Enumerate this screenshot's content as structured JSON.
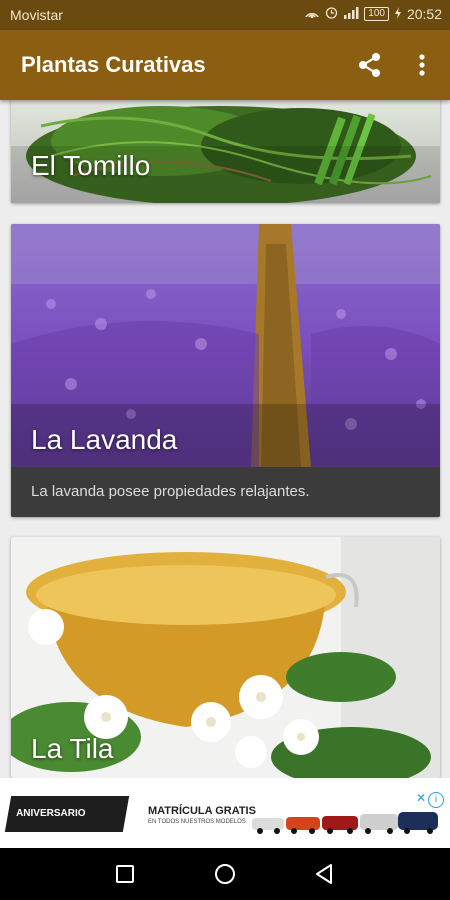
{
  "status_bar": {
    "carrier": "Movistar",
    "battery": "100",
    "time": "20:52"
  },
  "app_bar": {
    "title": "Plantas Curativas",
    "icons": [
      "share-icon",
      "more-vert-icon"
    ]
  },
  "cards": [
    {
      "title": "El Tomillo",
      "description": ""
    },
    {
      "title": "La Lavanda",
      "description": "La lavanda posee propiedades relajantes."
    },
    {
      "title": "La Tila",
      "description": ""
    }
  ],
  "ad": {
    "badge": "ANIVERSARIO",
    "headline": "MATRÍCULA GRATIS",
    "subline": "EN TODOS NUESTROS MODELOS"
  },
  "nav": {
    "icons": [
      "recent-apps-icon",
      "home-icon",
      "back-icon"
    ]
  },
  "colors": {
    "status_bar": "#6b4a0f",
    "app_bar": "#8b5e12",
    "card_desc_bg": "#3b3b3b"
  }
}
